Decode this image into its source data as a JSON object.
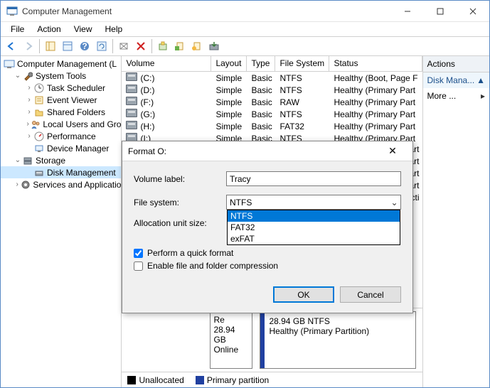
{
  "window": {
    "title": "Computer Management"
  },
  "menu": {
    "file": "File",
    "action": "Action",
    "view": "View",
    "help": "Help"
  },
  "tree": {
    "root": "Computer Management (L",
    "systools": "System Tools",
    "tasksched": "Task Scheduler",
    "eventviewer": "Event Viewer",
    "sharedfolders": "Shared Folders",
    "localusers": "Local Users and Gro",
    "performance": "Performance",
    "devmgr": "Device Manager",
    "storage": "Storage",
    "diskmgmt": "Disk Management",
    "services": "Services and Applicatio"
  },
  "volcols": {
    "volume": "Volume",
    "layout": "Layout",
    "type": "Type",
    "fs": "File System",
    "status": "Status"
  },
  "volumes": [
    {
      "name": "(C:)",
      "layout": "Simple",
      "type": "Basic",
      "fs": "NTFS",
      "status": "Healthy (Boot, Page F"
    },
    {
      "name": "(D:)",
      "layout": "Simple",
      "type": "Basic",
      "fs": "NTFS",
      "status": "Healthy (Primary Part"
    },
    {
      "name": "(F:)",
      "layout": "Simple",
      "type": "Basic",
      "fs": "RAW",
      "status": "Healthy (Primary Part"
    },
    {
      "name": "(G:)",
      "layout": "Simple",
      "type": "Basic",
      "fs": "NTFS",
      "status": "Healthy (Primary Part"
    },
    {
      "name": "(H:)",
      "layout": "Simple",
      "type": "Basic",
      "fs": "FAT32",
      "status": "Healthy (Primary Part"
    },
    {
      "name": "(I:)",
      "layout": "Simple",
      "type": "Basic",
      "fs": "NTFS",
      "status": "Healthy (Primary Part"
    }
  ],
  "peek": [
    "(Primary Part",
    "(Primary Part",
    "(Primary Part",
    "(Primary Part",
    "(System, Acti"
  ],
  "disk": {
    "leftline1": "Re",
    "leftline2": "28.94 GB",
    "leftline3": "Online",
    "rightline1": "28.94 GB NTFS",
    "rightline2": "Healthy (Primary Partition)"
  },
  "legend": {
    "unalloc": "Unallocated",
    "primary": "Primary partition"
  },
  "actions": {
    "header": "Actions",
    "diskmana": "Disk Mana...",
    "more": "More ..."
  },
  "dialog": {
    "title": "Format O:",
    "vol_label_lbl": "Volume label:",
    "vol_label_val": "Tracy",
    "fs_lbl": "File system:",
    "fs_val": "NTFS",
    "fs_opts": [
      "NTFS",
      "FAT32",
      "exFAT"
    ],
    "alloc_lbl": "Allocation unit size:",
    "quickfmt": "Perform a quick format",
    "compress": "Enable file and folder compression",
    "ok": "OK",
    "cancel": "Cancel"
  }
}
